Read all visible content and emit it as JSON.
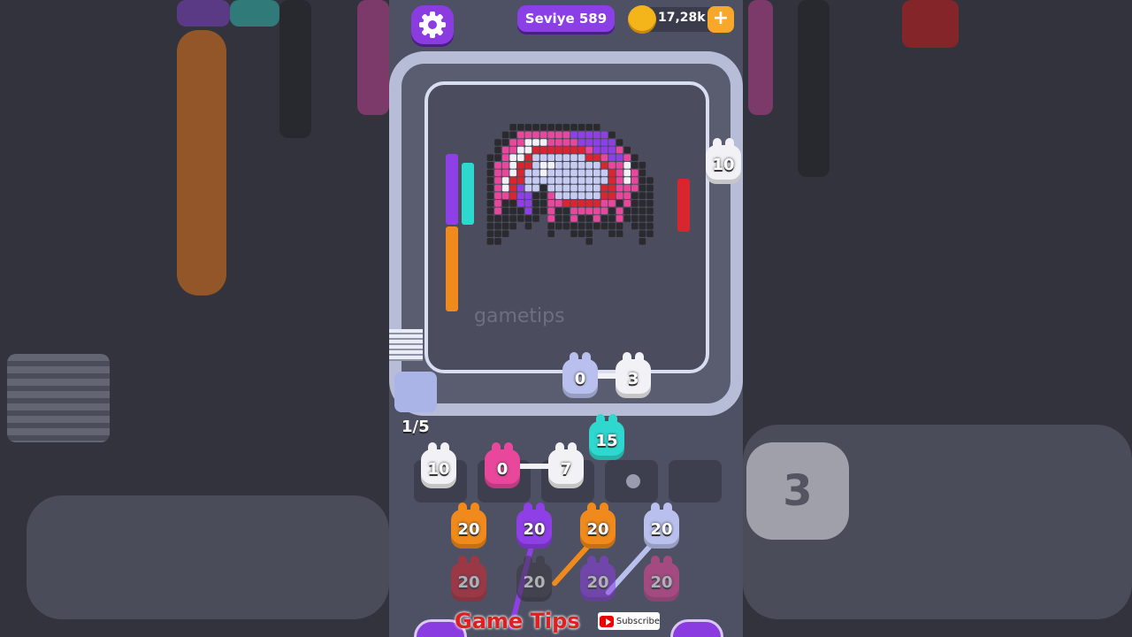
{
  "header": {
    "level_label": "Seviye 589",
    "coins": "17,28k",
    "add_label": "+",
    "settings_icon": "gear-icon"
  },
  "board": {
    "watermark": "gametips",
    "queue_counter": "1/5"
  },
  "track_pieces": [
    {
      "value": "10",
      "color": "#f2f2f6"
    },
    {
      "value": "0",
      "color": "#b9c0ee"
    },
    {
      "value": "3",
      "color": "#f2f2f6"
    }
  ],
  "holding_slots": [
    {
      "value": "10",
      "color": "#f2f2f6"
    },
    {
      "value": "0",
      "color": "#e9479b"
    },
    {
      "value": "7",
      "color": "#f2f2f6"
    },
    {
      "value": "15",
      "color": "#2fd8cf"
    }
  ],
  "supply_row_1": [
    {
      "value": "20",
      "color": "#f08a1c"
    },
    {
      "value": "20",
      "color": "#8f3fe6"
    },
    {
      "value": "20",
      "color": "#f08a1c"
    },
    {
      "value": "20",
      "color": "#b9c0ee"
    }
  ],
  "supply_row_2": [
    {
      "value": "20",
      "color": "#d9252e"
    },
    {
      "value": "20",
      "color": "#3a3a3f"
    },
    {
      "value": "20",
      "color": "#8f3fe6"
    },
    {
      "value": "20",
      "color": "#e9479b"
    }
  ],
  "overlay": {
    "channel_name": "Game Tips",
    "subscribe_label": "Subscribe"
  },
  "side_preview": {
    "right_piece_value": "3"
  }
}
